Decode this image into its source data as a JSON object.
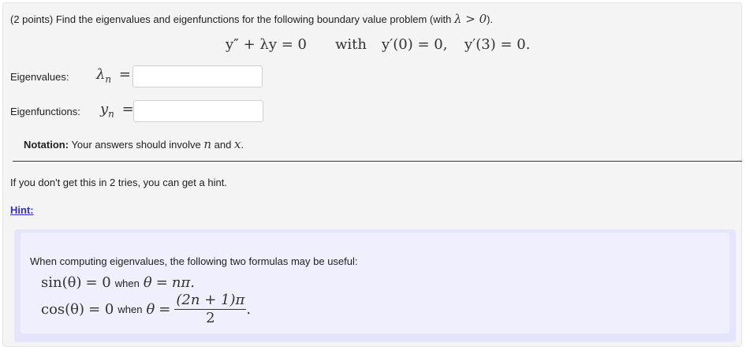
{
  "problem": {
    "points": "(2 points)",
    "prompt": "Find the eigenvalues and eigenfunctions for the following boundary value problem (with",
    "condition": "λ > 0",
    "close_paren": ").",
    "equation": {
      "lhs": "y″ + λy = 0",
      "with_word": "with",
      "bc1": "y′(0) = 0,",
      "bc2": "y′(3) = 0."
    }
  },
  "eigenvalues": {
    "label": "Eigenvalues:",
    "symbol": "λ",
    "sub": "n",
    "eq": "=",
    "value": ""
  },
  "eigenfunctions": {
    "label": "Eigenfunctions:",
    "symbol": "y",
    "sub": "n",
    "eq": "=",
    "value": ""
  },
  "notation": {
    "bold": "Notation:",
    "text": "Your answers should involve",
    "var1": "n",
    "and": "and",
    "var2": "x",
    "period": "."
  },
  "tries_text": "If you don't get this in 2 tries, you can get a hint.",
  "hint": {
    "link_label": "Hint:",
    "intro": "When computing eigenvalues, the following two formulas may be useful:",
    "formula1": {
      "func": "sin(θ)",
      "eq": "= 0",
      "when": "when",
      "cond_lhs": "θ",
      "cond_eq": "=",
      "cond_rhs": "nπ."
    },
    "formula2": {
      "func": "cos(θ)",
      "eq": "= 0",
      "when": "when",
      "cond_lhs": "θ",
      "cond_eq": "=",
      "numerator": "(2n + 1)π",
      "denominator": "2",
      "period": "."
    }
  }
}
